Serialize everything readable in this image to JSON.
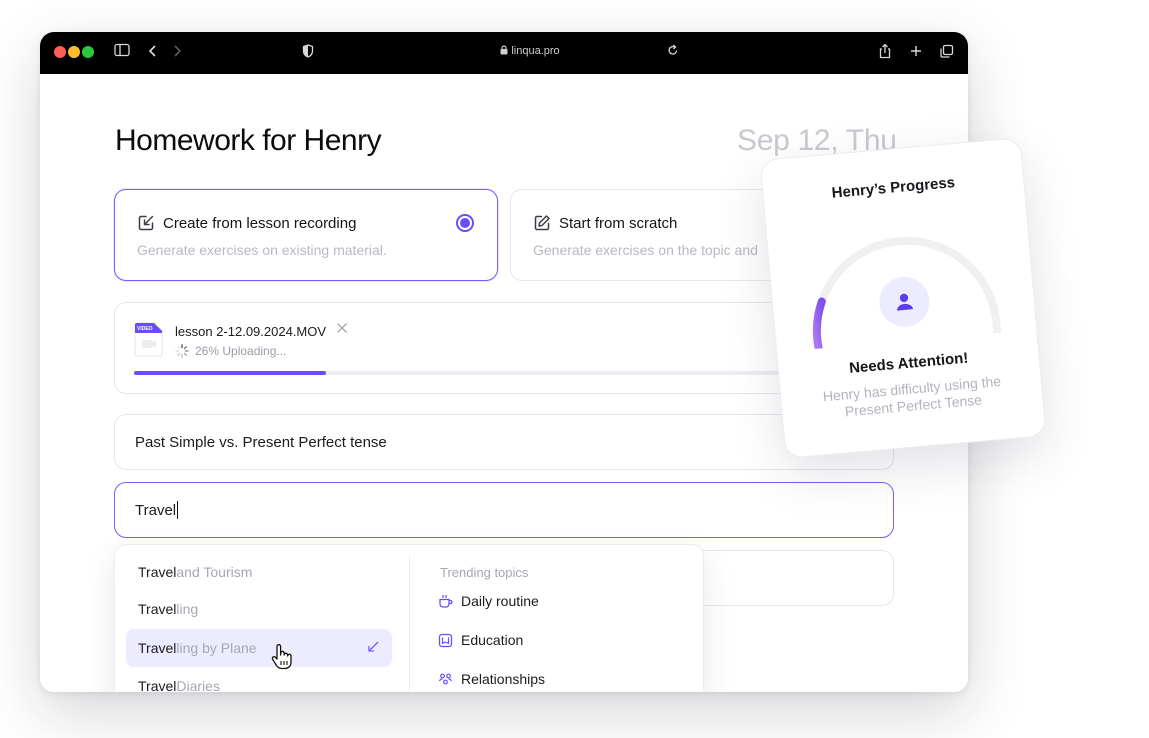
{
  "browser": {
    "url": "linqua.pro"
  },
  "page": {
    "title": "Homework for Henry",
    "date": "Sep 12, Thu"
  },
  "options": [
    {
      "title": "Create from lesson recording",
      "subtitle": "Generate exercises on existing material.",
      "selected": true
    },
    {
      "title": "Start from scratch",
      "subtitle": "Generate exercises on the topic and",
      "selected": false
    }
  ],
  "upload": {
    "badge": "VIDEO",
    "file_name": "lesson 2-12.09.2024.MOV",
    "status": "26% Uploading...",
    "progress": 0.26
  },
  "topic_field": {
    "value": "Past Simple vs. Present Perfect tense"
  },
  "search_field": {
    "value": "Travel"
  },
  "suggestions": [
    {
      "typed": "Travel",
      "rest": " and Tourism"
    },
    {
      "typed": "Travel",
      "rest": "ling"
    },
    {
      "typed": "Travel",
      "rest": "ling by Plane"
    },
    {
      "typed": "Travel",
      "rest": " Diaries"
    }
  ],
  "trending": {
    "title": "Trending topics",
    "items": [
      {
        "label": "Daily routine",
        "icon": "coffee-cup-icon"
      },
      {
        "label": "Education",
        "icon": "book-icon"
      },
      {
        "label": "Relationships",
        "icon": "people-icon"
      }
    ]
  },
  "progress_card": {
    "title": "Henry’s Progress",
    "status": "Needs Attention!",
    "note": "Henry has difficulty using the Present Perfect Tense",
    "level": 0.2
  },
  "colors": {
    "accent": "#6d4cff",
    "gauge_start": "#b07cf2",
    "gauge_end": "#7d4ff0"
  }
}
